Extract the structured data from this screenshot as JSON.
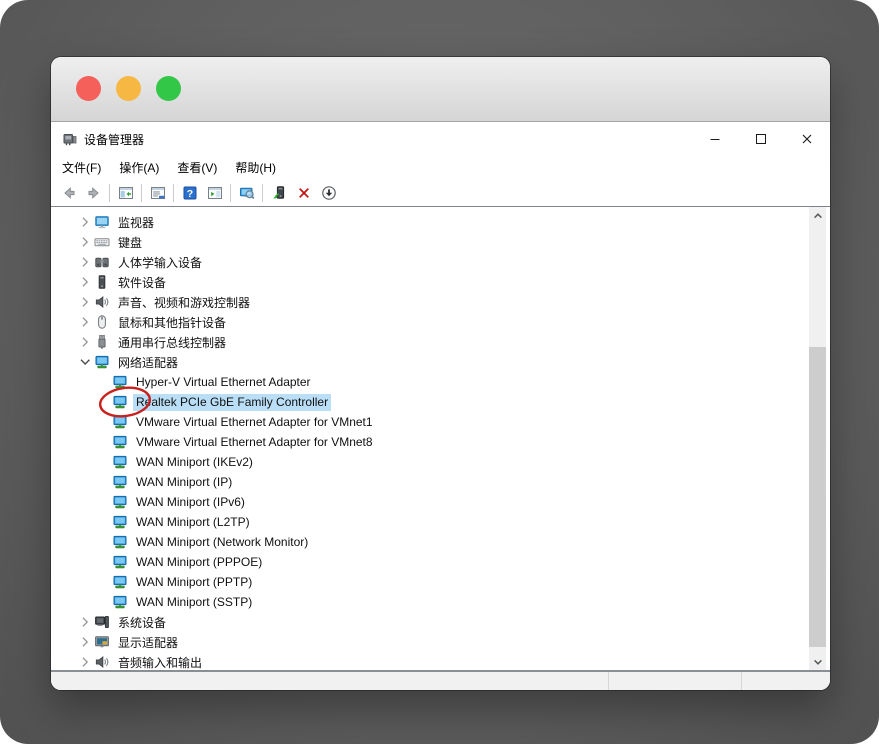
{
  "chrome": {
    "traffic_lights": [
      {
        "name": "close-light",
        "color": "#f5605a"
      },
      {
        "name": "minimize-light",
        "color": "#f6b843"
      },
      {
        "name": "zoom-light",
        "color": "#33c748"
      }
    ]
  },
  "app": {
    "title": "设备管理器",
    "app_icon": "device-manager-icon",
    "caption_buttons": [
      {
        "name": "minimize-button",
        "icon": "minimize-icon"
      },
      {
        "name": "maximize-button",
        "icon": "maximize-icon"
      },
      {
        "name": "close-button",
        "icon": "close-icon"
      }
    ],
    "menu": [
      {
        "label": "文件(F)"
      },
      {
        "label": "操作(A)"
      },
      {
        "label": "查看(V)"
      },
      {
        "label": "帮助(H)"
      }
    ],
    "toolbar": [
      {
        "icon": "back-icon"
      },
      {
        "icon": "forward-icon"
      },
      {
        "separator": true
      },
      {
        "icon": "console-tree-icon"
      },
      {
        "separator": true
      },
      {
        "icon": "properties-icon"
      },
      {
        "separator": true
      },
      {
        "icon": "help-icon"
      },
      {
        "icon": "action-pane-icon"
      },
      {
        "separator": true
      },
      {
        "icon": "scan-hardware-icon"
      },
      {
        "separator": true
      },
      {
        "icon": "update-driver-icon"
      },
      {
        "icon": "uninstall-device-icon"
      },
      {
        "icon": "disable-device-icon"
      }
    ]
  },
  "tree": {
    "items": [
      {
        "label": "监视器",
        "icon": "monitor-icon",
        "level": 0,
        "chevron": "collapsed"
      },
      {
        "label": "键盘",
        "icon": "keyboard-icon",
        "level": 0,
        "chevron": "collapsed"
      },
      {
        "label": "人体学输入设备",
        "icon": "hid-icon",
        "level": 0,
        "chevron": "collapsed"
      },
      {
        "label": "软件设备",
        "icon": "software-device-icon",
        "level": 0,
        "chevron": "collapsed"
      },
      {
        "label": "声音、视频和游戏控制器",
        "icon": "speaker-icon",
        "level": 0,
        "chevron": "collapsed"
      },
      {
        "label": "鼠标和其他指针设备",
        "icon": "mouse-icon",
        "level": 0,
        "chevron": "collapsed"
      },
      {
        "label": "通用串行总线控制器",
        "icon": "usb-icon",
        "level": 0,
        "chevron": "collapsed"
      },
      {
        "label": "网络适配器",
        "icon": "network-adapter-icon",
        "level": 0,
        "chevron": "expanded"
      },
      {
        "label": "Hyper-V Virtual Ethernet Adapter",
        "icon": "network-adapter-icon",
        "level": 1
      },
      {
        "label": "Realtek PCIe GbE Family Controller",
        "icon": "network-adapter-icon",
        "level": 1,
        "selected": true,
        "annotated": true
      },
      {
        "label": "VMware Virtual Ethernet Adapter for VMnet1",
        "icon": "network-adapter-icon",
        "level": 1
      },
      {
        "label": "VMware Virtual Ethernet Adapter for VMnet8",
        "icon": "network-adapter-icon",
        "level": 1
      },
      {
        "label": "WAN Miniport (IKEv2)",
        "icon": "network-adapter-icon",
        "level": 1
      },
      {
        "label": "WAN Miniport (IP)",
        "icon": "network-adapter-icon",
        "level": 1
      },
      {
        "label": "WAN Miniport (IPv6)",
        "icon": "network-adapter-icon",
        "level": 1
      },
      {
        "label": "WAN Miniport (L2TP)",
        "icon": "network-adapter-icon",
        "level": 1
      },
      {
        "label": "WAN Miniport (Network Monitor)",
        "icon": "network-adapter-icon",
        "level": 1
      },
      {
        "label": "WAN Miniport (PPPOE)",
        "icon": "network-adapter-icon",
        "level": 1
      },
      {
        "label": "WAN Miniport (PPTP)",
        "icon": "network-adapter-icon",
        "level": 1
      },
      {
        "label": "WAN Miniport (SSTP)",
        "icon": "network-adapter-icon",
        "level": 1
      },
      {
        "label": "系统设备",
        "icon": "system-device-icon",
        "level": 0,
        "chevron": "collapsed"
      },
      {
        "label": "显示适配器",
        "icon": "display-adapter-icon",
        "level": 0,
        "chevron": "collapsed"
      },
      {
        "label": "音频输入和输出",
        "icon": "audio-endpoint-icon",
        "level": 0,
        "chevron": "collapsed"
      }
    ]
  },
  "annotation": {
    "shape": "ellipse",
    "color": "#c9211e",
    "target": "Realtek PCIe GbE Family Controller"
  },
  "statusbar": {
    "sections": [
      "",
      "",
      ""
    ]
  },
  "colors": {
    "selection": "#b9def5",
    "help_blue": "#2a70cf",
    "uninstall_red": "#c40f0f"
  }
}
